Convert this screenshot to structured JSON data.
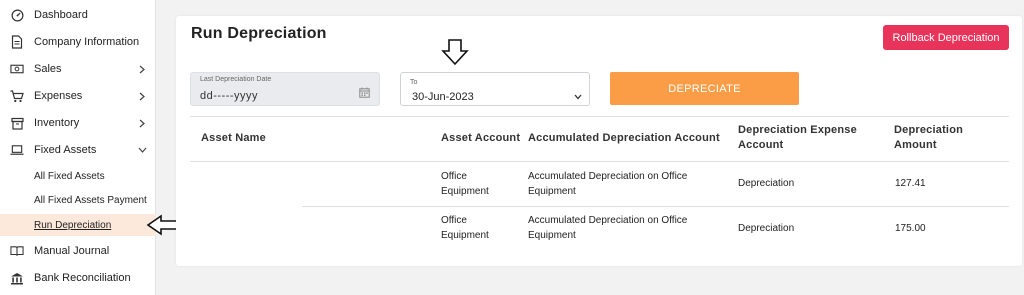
{
  "sidebar": {
    "items": [
      {
        "label": "Dashboard",
        "icon": "gauge-icon"
      },
      {
        "label": "Company Information",
        "icon": "document-icon"
      },
      {
        "label": "Sales",
        "icon": "cash-icon"
      },
      {
        "label": "Expenses",
        "icon": "cart-icon"
      },
      {
        "label": "Inventory",
        "icon": "box-icon"
      },
      {
        "label": "Fixed Assets",
        "icon": "laptop-icon"
      }
    ],
    "sub_items": [
      {
        "label": "All Fixed Assets"
      },
      {
        "label": "All Fixed Assets Payment"
      },
      {
        "label": "Run Depreciation"
      }
    ],
    "bottom_items": [
      {
        "label": "Manual Journal",
        "icon": "book-icon"
      },
      {
        "label": "Bank Reconciliation",
        "icon": "bank-icon"
      }
    ]
  },
  "main": {
    "title": "Run Depreciation",
    "rollback_label": "Rollback Depreciation",
    "last_date": {
      "caption": "Last Depreciation Date",
      "value": "dd-----yyyy"
    },
    "to_date": {
      "caption": "To",
      "value": "30-Jun-2023"
    },
    "depreciate_label": "DEPRECIATE"
  },
  "table": {
    "headers": {
      "asset_name": "Asset Name",
      "asset_account": "Asset Account",
      "accum_account": "Accumulated Depreciation Account",
      "expense_account_1": "Depreciation Expense",
      "expense_account_2": "Account",
      "amount_1": "Depreciation",
      "amount_2": "Amount"
    },
    "rows": [
      {
        "asset_account_1": "Office",
        "asset_account_2": "Equipment",
        "accum_1": "Accumulated Depreciation on Office",
        "accum_2": "Equipment",
        "expense": "Depreciation",
        "amount": "127.41"
      },
      {
        "asset_account_1": "Office",
        "asset_account_2": "Equipment",
        "accum_1": "Accumulated Depreciation on Office",
        "accum_2": "Equipment",
        "expense": "Depreciation",
        "amount": "175.00"
      }
    ]
  },
  "colors": {
    "accent_orange": "#fb9c46",
    "rollback_red": "#e8345a",
    "active_bg": "#fde8dc"
  }
}
